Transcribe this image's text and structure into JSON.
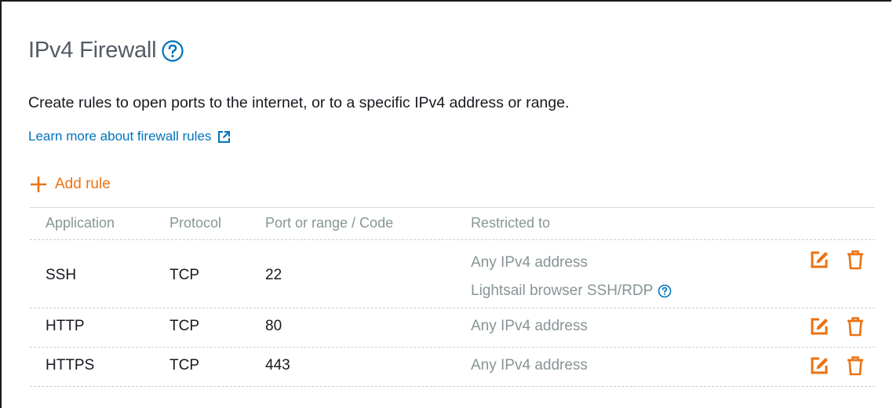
{
  "header": {
    "title": "IPv4 Firewall"
  },
  "description": "Create rules to open ports to the internet, or to a specific IPv4 address or range.",
  "learn_more": {
    "label": "Learn more about firewall rules"
  },
  "add_rule": {
    "label": "Add rule"
  },
  "table": {
    "columns": [
      "Application",
      "Protocol",
      "Port or range / Code",
      "Restricted to"
    ],
    "rows": [
      {
        "application": "SSH",
        "protocol": "TCP",
        "port": "22",
        "restricted_line1": "Any IPv4 address",
        "restricted_line2": "Lightsail browser SSH/RDP"
      },
      {
        "application": "HTTP",
        "protocol": "TCP",
        "port": "80",
        "restricted_line1": "Any IPv4 address"
      },
      {
        "application": "HTTPS",
        "protocol": "TCP",
        "port": "443",
        "restricted_line1": "Any IPv4 address"
      }
    ]
  },
  "colors": {
    "accent_orange": "#ec7211",
    "link_blue": "#0073bb",
    "muted_gray": "#879596",
    "title_gray": "#545b64"
  },
  "icons": [
    "help-icon",
    "external-link-icon",
    "plus-icon",
    "edit-icon",
    "delete-icon"
  ]
}
